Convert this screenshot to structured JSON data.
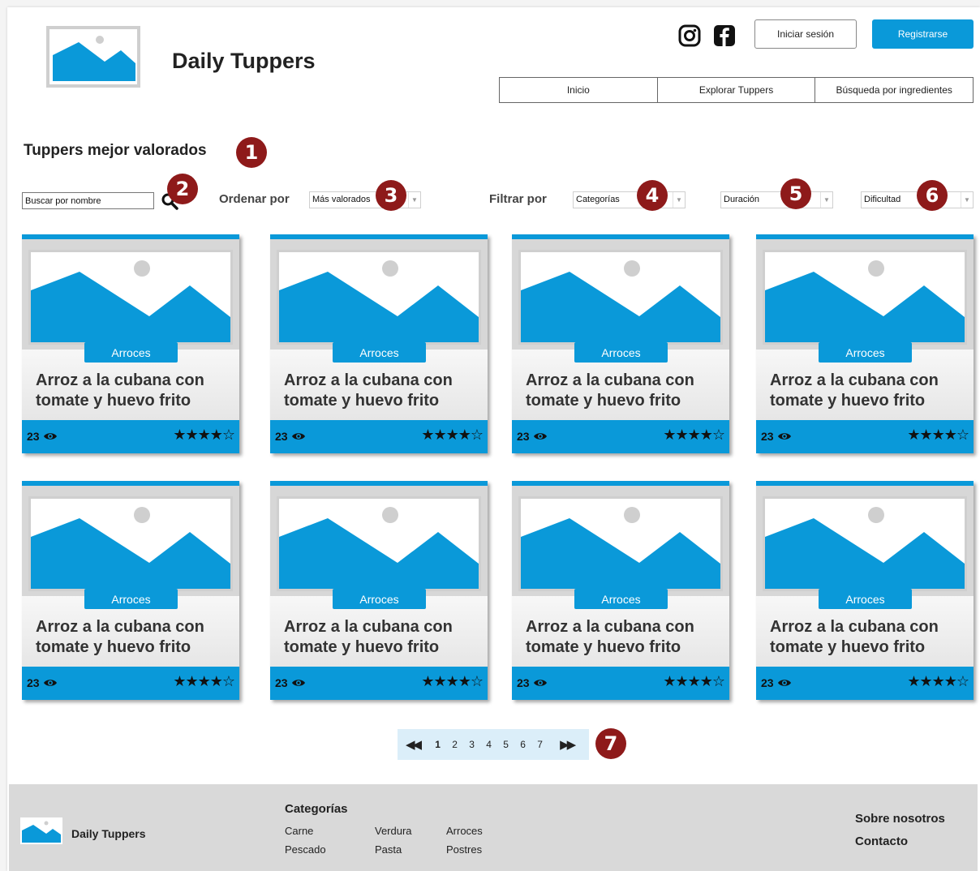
{
  "header": {
    "site_title": "Daily Tuppers",
    "login_label": "Iniciar sesión",
    "register_label": "Registrarse",
    "social": [
      "instagram-icon",
      "facebook-icon"
    ]
  },
  "nav": {
    "items": [
      {
        "label": "Inicio"
      },
      {
        "label": "Explorar Tuppers"
      },
      {
        "label": "Búsqueda por ingredientes"
      }
    ]
  },
  "main": {
    "section_title": "Tuppers mejor valorados",
    "search_value": "Buscar por nombre",
    "sort_label": "Ordenar por",
    "sort_value": "Más valorados",
    "filter_label": "Filtrar por",
    "filters": [
      {
        "value": "Categorías"
      },
      {
        "value": "Duración"
      },
      {
        "value": "Dificultad"
      }
    ],
    "badges": [
      "1",
      "2",
      "3",
      "4",
      "5",
      "6",
      "7"
    ]
  },
  "cards": [
    {
      "category": "Arroces",
      "title": "Arroz a la cubana con tomate y huevo frito",
      "views": "23",
      "rating": 4,
      "stars": "★★★★☆"
    },
    {
      "category": "Arroces",
      "title": "Arroz a la cubana con tomate y huevo frito",
      "views": "23",
      "rating": 4,
      "stars": "★★★★☆"
    },
    {
      "category": "Arroces",
      "title": "Arroz a la cubana con tomate y huevo frito",
      "views": "23",
      "rating": 4,
      "stars": "★★★★☆"
    },
    {
      "category": "Arroces",
      "title": "Arroz a la cubana con tomate y huevo frito",
      "views": "23",
      "rating": 4,
      "stars": "★★★★☆"
    },
    {
      "category": "Arroces",
      "title": "Arroz a la cubana con tomate y huevo frito",
      "views": "23",
      "rating": 4,
      "stars": "★★★★☆"
    },
    {
      "category": "Arroces",
      "title": "Arroz a la cubana con tomate y huevo frito",
      "views": "23",
      "rating": 4,
      "stars": "★★★★☆"
    },
    {
      "category": "Arroces",
      "title": "Arroz a la cubana con tomate y huevo frito",
      "views": "23",
      "rating": 4,
      "stars": "★★★★☆"
    },
    {
      "category": "Arroces",
      "title": "Arroz a la cubana con tomate y huevo frito",
      "views": "23",
      "rating": 4,
      "stars": "★★★★☆"
    }
  ],
  "pagination": {
    "first": "◀◀",
    "last": "▶▶",
    "pages": [
      "1",
      "2",
      "3",
      "4",
      "5",
      "6",
      "7"
    ],
    "current": "1"
  },
  "footer": {
    "brand": "Daily Tuppers",
    "categories_title": "Categorías",
    "categories": [
      "Carne",
      "Verdura",
      "Arroces",
      "Pescado",
      "Pasta",
      "Postres"
    ],
    "about": "Sobre nosotros",
    "contact": "Contacto"
  },
  "colors": {
    "accent": "#0a99d9",
    "badge": "#8e1a1a",
    "card_bg": "#d7d7d7",
    "footer_bg": "#d9d9d9"
  }
}
